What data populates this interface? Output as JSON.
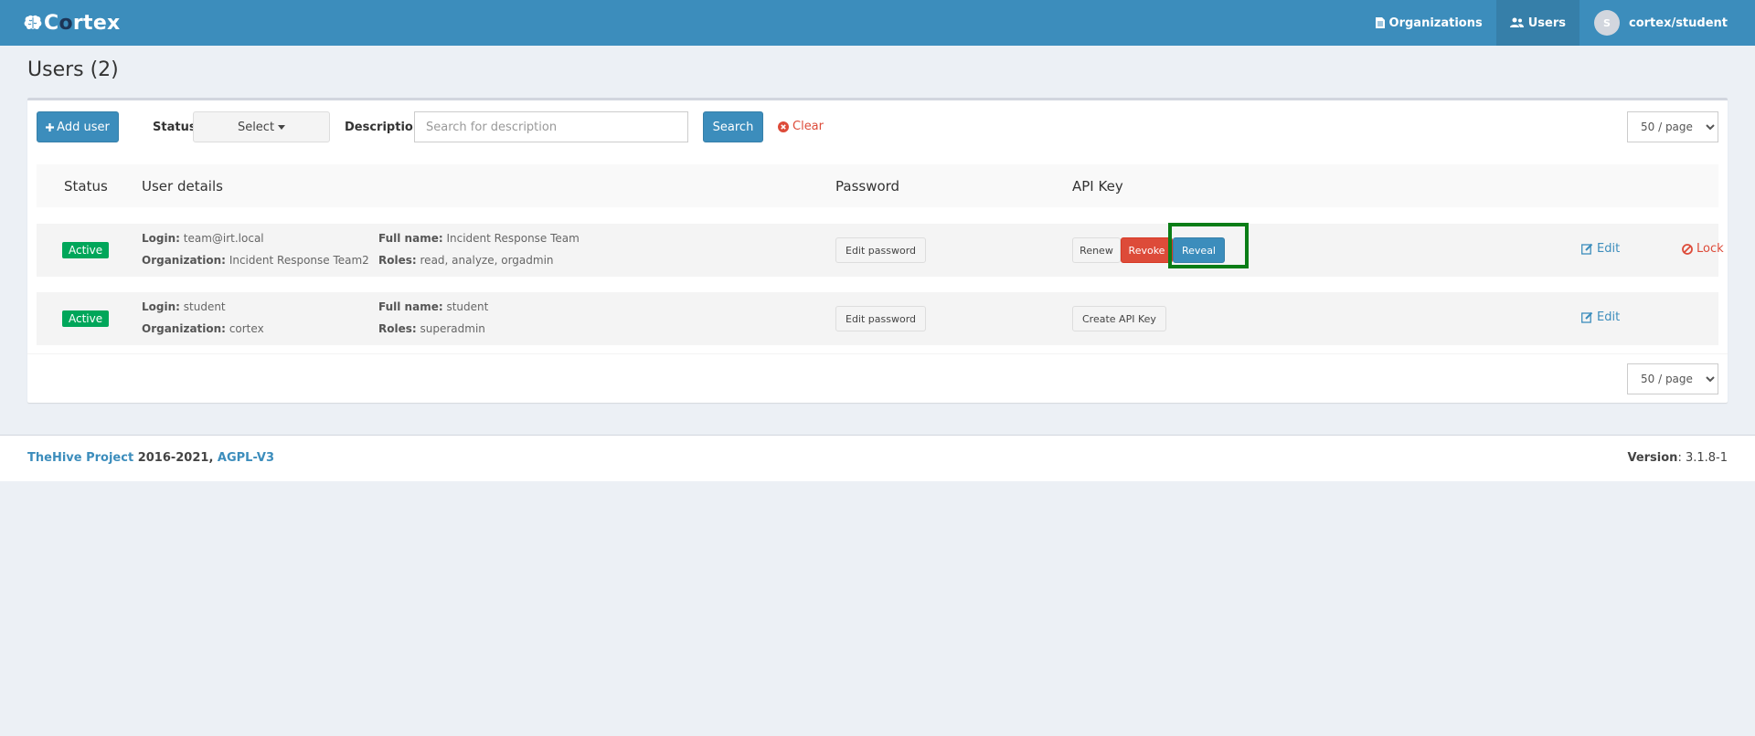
{
  "brand": {
    "name_part1": "C",
    "name_part2": "rtex"
  },
  "nav": {
    "organizations": "Organizations",
    "users": "Users",
    "avatar_initial": "S",
    "user_label": "cortex/student"
  },
  "page": {
    "title": "Users (2)"
  },
  "toolbar": {
    "add_user": "Add user",
    "status_label": "Status",
    "status_select": "Select",
    "description_label": "Description",
    "description_placeholder": "Search for description",
    "search": "Search",
    "clear": "Clear",
    "per_page": "50 / page"
  },
  "table": {
    "headers": {
      "status": "Status",
      "user_details": "User details",
      "password": "Password",
      "api_key": "API Key"
    },
    "field_labels": {
      "login": "Login:",
      "organization": "Organization:",
      "full_name": "Full name:",
      "roles": "Roles:"
    },
    "rows": [
      {
        "status": "Active",
        "login": "team@irt.local",
        "organization": "Incident Response Team2",
        "full_name": "Incident Response Team",
        "roles": "read, analyze, orgadmin",
        "edit_password": "Edit password",
        "api_actions": {
          "renew": "Renew",
          "revoke": "Revoke",
          "reveal": "Reveal"
        },
        "edit": "Edit",
        "lock": "Lock"
      },
      {
        "status": "Active",
        "login": "student",
        "organization": "cortex",
        "full_name": "student",
        "roles": "superadmin",
        "edit_password": "Edit password",
        "api_actions": {
          "create": "Create API Key"
        },
        "edit": "Edit"
      }
    ]
  },
  "footer": {
    "project": "TheHive Project",
    "years": "2016-2021,",
    "license": "AGPL-V3",
    "version_label": "Version",
    "version_value": ": 3.1.8-1"
  },
  "colors": {
    "navbar": "#3c8dbc",
    "active_badge": "#00a65a",
    "danger": "#dd4b39",
    "highlight": "#0a7d16"
  }
}
